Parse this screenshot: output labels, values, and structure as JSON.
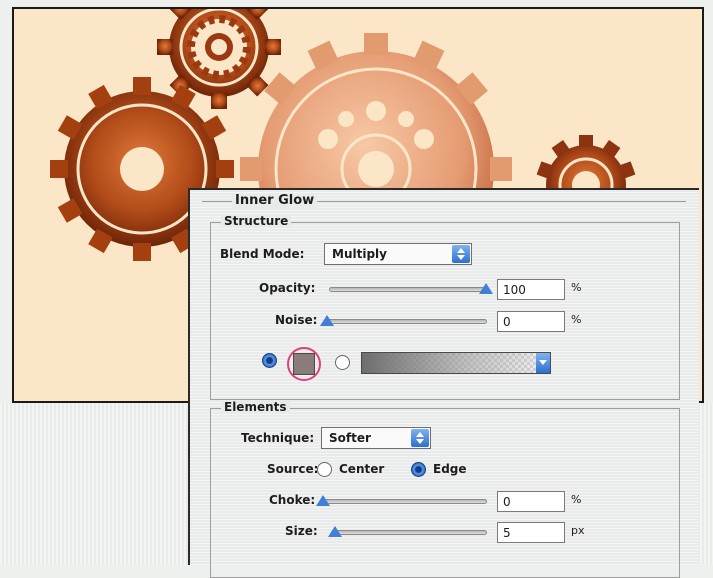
{
  "dialog": {
    "title": "Inner Glow",
    "structure": {
      "group_title": "Structure",
      "blend_mode_label": "Blend Mode:",
      "blend_mode_value": "Multiply",
      "opacity_label": "Opacity:",
      "opacity_value": "100",
      "opacity_unit": "%",
      "opacity_level": 1.0,
      "noise_label": "Noise:",
      "noise_value": "0",
      "noise_unit": "%",
      "noise_level": 0.0,
      "color_swatch": "#8a7c79"
    },
    "elements": {
      "group_title": "Elements",
      "technique_label": "Technique:",
      "technique_value": "Softer",
      "source_label": "Source:",
      "source_center_label": "Center",
      "source_edge_label": "Edge",
      "choke_label": "Choke:",
      "choke_value": "0",
      "choke_unit": "%",
      "choke_level": 0.0,
      "size_label": "Size:",
      "size_value": "5",
      "size_unit": "px",
      "size_level": 0.03
    }
  },
  "colors": {
    "accent": "#3f7fd6",
    "highlight_ring": "#e0407a",
    "canvas": "#fbe6c8",
    "gear_dark": "#9b3a12",
    "gear_light": "#e8a27a"
  }
}
